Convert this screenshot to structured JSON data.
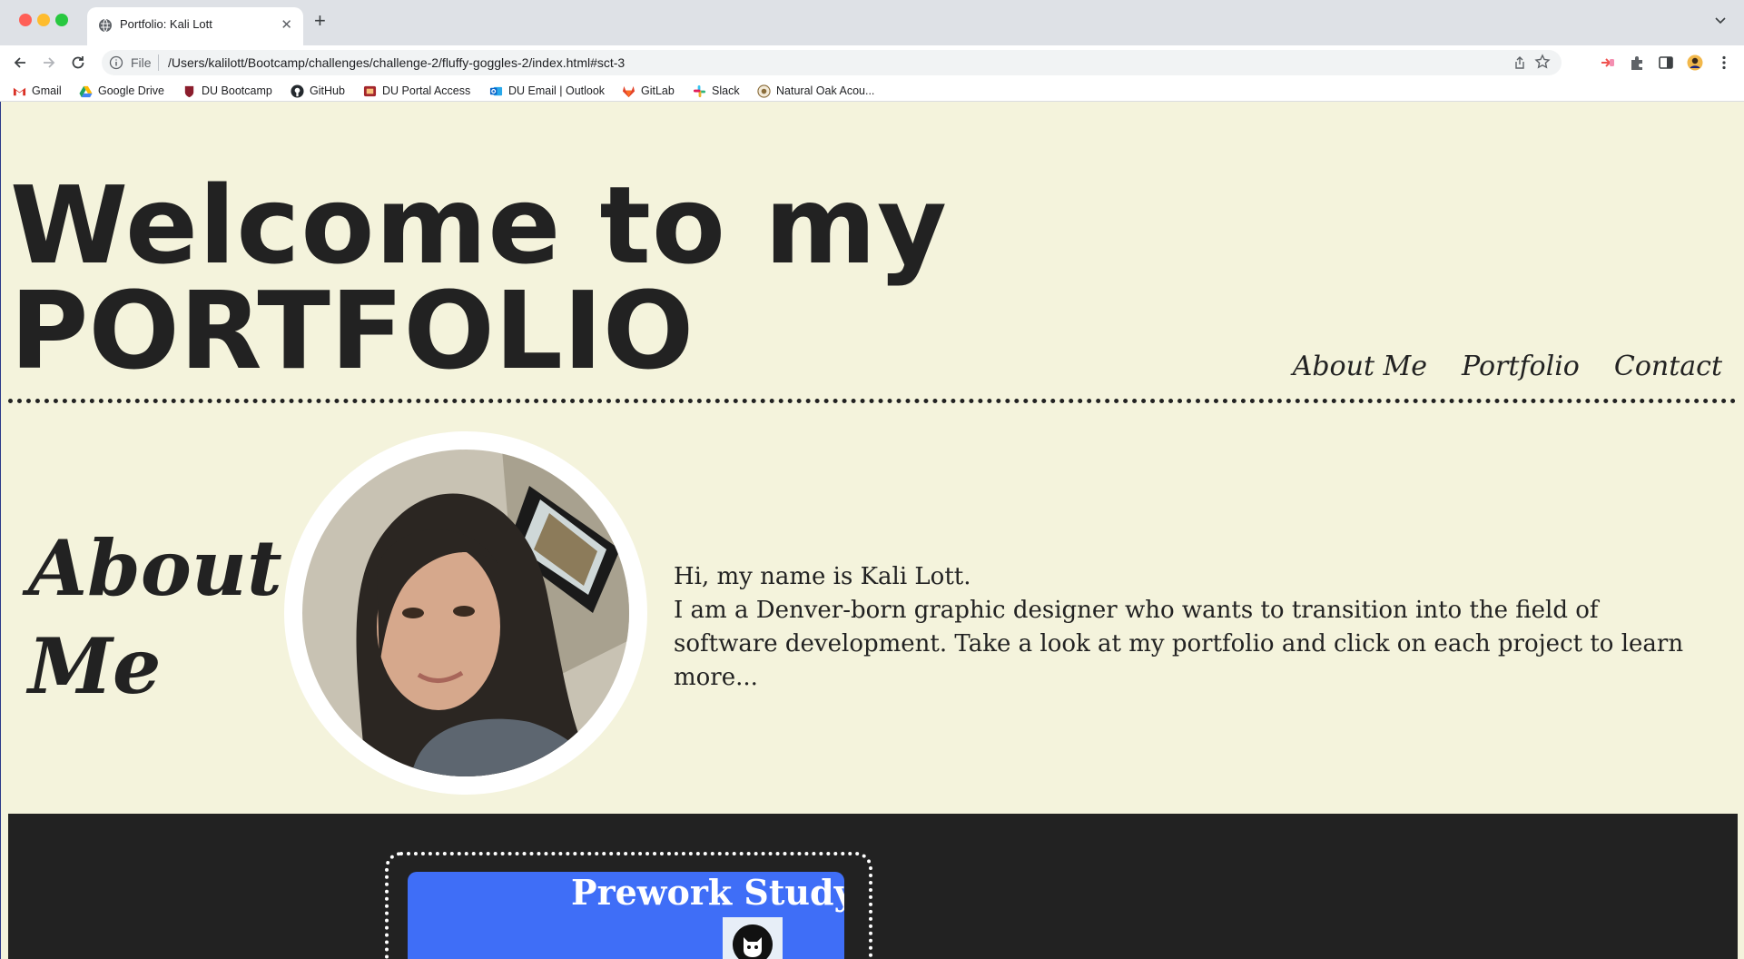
{
  "browser": {
    "tab_title": "Portfolio: Kali Lott",
    "url_scheme": "File",
    "url": "/Users/kalilott/Bootcamp/challenges/challenge-2/fluffy-goggles-2/index.html#sct-3",
    "bookmarks": [
      {
        "label": "Gmail",
        "icon": "gmail-icon",
        "color": "#d93025"
      },
      {
        "label": "Google Drive",
        "icon": "google-drive-icon",
        "color": "#1fa463"
      },
      {
        "label": "DU Bootcamp",
        "icon": "du-shield-icon",
        "color": "#8b1d2c"
      },
      {
        "label": "GitHub",
        "icon": "github-icon",
        "color": "#24292e"
      },
      {
        "label": "DU Portal Access",
        "icon": "du-portal-icon",
        "color": "#a4262c"
      },
      {
        "label": "DU Email | Outlook",
        "icon": "outlook-icon",
        "color": "#0a64c8"
      },
      {
        "label": "GitLab",
        "icon": "gitlab-icon",
        "color": "#e24329"
      },
      {
        "label": "Slack",
        "icon": "slack-icon",
        "color": "#4a154b"
      },
      {
        "label": "Natural Oak Acou...",
        "icon": "site-icon",
        "color": "#8a6d3b"
      }
    ]
  },
  "header": {
    "title_line1": "Welcome to my",
    "title_line2": "PORTFOLIO",
    "nav": [
      "About Me",
      "Portfolio",
      "Contact"
    ]
  },
  "about": {
    "heading_line1": "About",
    "heading_line2": "Me",
    "text_line1": "Hi, my name is Kali Lott.",
    "text_line2": "I am a Denver-born graphic designer who wants to transition into the field of software development. Take a look at my portfolio and click on each project to learn more..."
  },
  "portfolio": {
    "card_title": "Prework Study G"
  },
  "colors": {
    "page_bg": "#f4f3dc",
    "text": "#222222",
    "card_blue": "#3f6ef7"
  }
}
